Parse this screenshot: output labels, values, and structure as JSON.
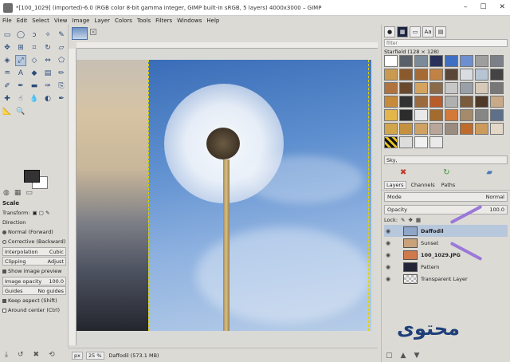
{
  "window": {
    "title": "*[100_1029] (imported)-6.0 (RGB color 8-bit gamma integer, GIMP built-in sRGB, 5 layers) 4000x3000 – GIMP",
    "controls": [
      "–",
      "☐",
      "✕"
    ]
  },
  "menu": [
    "File",
    "Edit",
    "Select",
    "View",
    "Image",
    "Layer",
    "Colors",
    "Tools",
    "Filters",
    "Windows",
    "Help"
  ],
  "tool_options": {
    "title": "Scale",
    "transform_label": "Transform:",
    "direction_label": "Direction",
    "direction_normal": "Normal (Forward)",
    "direction_corrective": "Corrective (Backward)",
    "interpolation_label": "Interpolation",
    "interpolation_value": "Cubic",
    "clipping_label": "Clipping",
    "clipping_value": "Adjust",
    "show_preview": "Show image preview",
    "image_opacity_label": "Image opacity",
    "image_opacity_value": "100.0",
    "guides_label": "Guides",
    "guides_value": "No guides",
    "keep_aspect": "Keep aspect (Shift)",
    "around_center": "Around center (Ctrl)"
  },
  "status": {
    "unit": "px",
    "zoom": "25 %",
    "layer_info": "Daffodil (573.1 MB)"
  },
  "patterns": {
    "filter_placeholder": "filter",
    "current": "Starfield (128 × 128)",
    "selected_name": "Sky,"
  },
  "layers": {
    "tabs": [
      "Layers",
      "Channels",
      "Paths"
    ],
    "mode_label": "Mode",
    "mode_value": "Normal",
    "opacity_label": "Opacity",
    "opacity_value": "100.0",
    "lock_label": "Lock:",
    "items": [
      {
        "name": "Daffodil",
        "selected": true,
        "thumb": "#8fa6c8"
      },
      {
        "name": "Sunset",
        "selected": false,
        "thumb": "#c9a27a"
      },
      {
        "name": "100_1029.JPG",
        "selected": false,
        "thumb": "#d07a4c"
      },
      {
        "name": "Pattern",
        "selected": false,
        "thumb": "#242436"
      },
      {
        "name": "Transparent Layer",
        "selected": false,
        "thumb": "#d8d8d8"
      }
    ]
  },
  "watermark": "محتوى",
  "colors": {
    "accent_arrow": "#9b78d9",
    "selection": "#b7c7dc",
    "guide": "#e2d200"
  }
}
